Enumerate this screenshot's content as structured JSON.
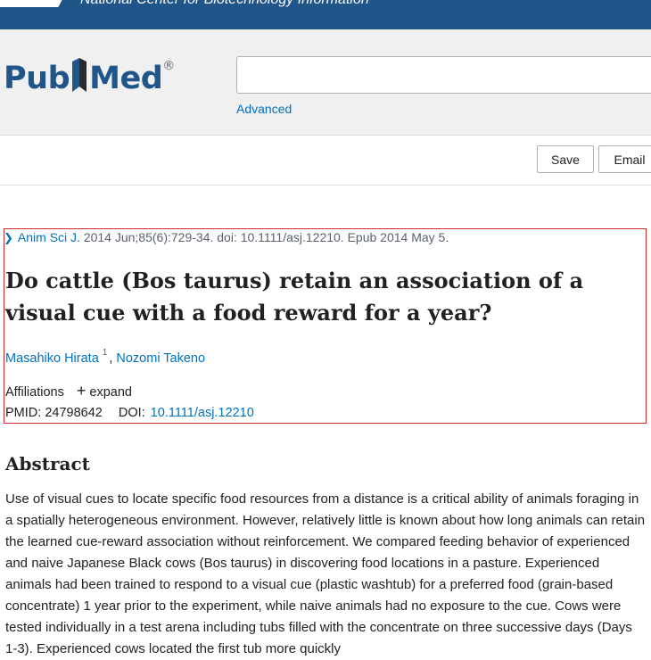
{
  "header": {
    "org_name": "National Center for Biotechnology Information",
    "brand_color": "#20558a"
  },
  "search": {
    "logo_text_pub": "Pub",
    "logo_text_med": "Med",
    "logo_registered": "®",
    "query": "",
    "advanced_label": "Advanced"
  },
  "actions": {
    "save_label": "Save",
    "email_label": "Email"
  },
  "article": {
    "journal": "Anim Sci J.",
    "citation": "2014 Jun;85(6):729-34. doi: 10.1111/asj.12210. Epub 2014 May 5.",
    "title": "Do cattle (Bos taurus) retain an association of a visual cue with a food reward for a year?",
    "authors": [
      {
        "name": "Masahiko Hirata",
        "affiliation_ref": "1"
      },
      {
        "name": "Nozomi Takeno"
      }
    ],
    "affiliations_label": "Affiliations",
    "expand_label": "expand",
    "pmid_label": "PMID:",
    "pmid": "24798642",
    "doi_label": "DOI:",
    "doi": "10.1111/asj.12210"
  },
  "abstract": {
    "heading": "Abstract",
    "text": "Use of visual cues to locate specific food resources from a distance is a critical ability of animals foraging in a spatially heterogeneous environment. However, relatively little is known about how long animals can retain the learned cue-reward association without reinforcement. We compared feeding behavior of experienced and naive Japanese Black cows (Bos taurus) in discovering food locations in a pasture. Experienced animals had been trained to respond to a visual cue (plastic washtub) for a preferred food (grain-based concentrate) 1 year prior to the experiment, while naive animals had no exposure to the cue. Cows were tested individually in a test arena including tubs filled with the concentrate on three successive days (Days 1-3). Experienced cows located the first tub more quickly"
  },
  "colors": {
    "link": "#0071bc",
    "highlight_border": "#cc2929"
  }
}
